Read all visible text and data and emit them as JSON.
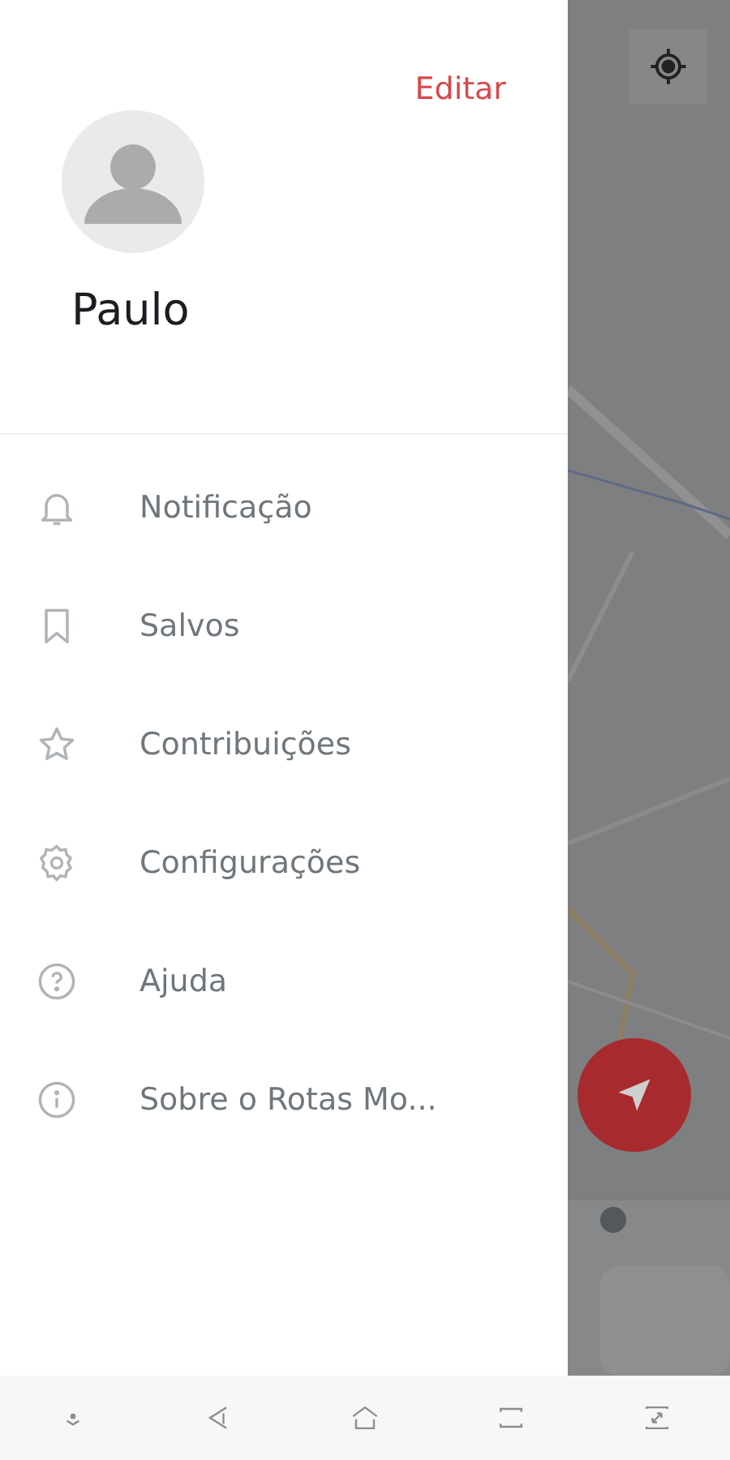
{
  "drawer": {
    "edit_link": "Editar",
    "user": {
      "name": "Paulo"
    },
    "menu": [
      {
        "kind": "bell",
        "label": "Notificação"
      },
      {
        "kind": "bookmark",
        "label": "Salvos"
      },
      {
        "kind": "star",
        "label": "Contribuições"
      },
      {
        "kind": "gear",
        "label": "Configurações"
      },
      {
        "kind": "help",
        "label": "Ajuda"
      },
      {
        "kind": "info",
        "label": "Sobre o Rotas Mo..."
      }
    ]
  },
  "nav_bar": [
    {
      "kind": "hide"
    },
    {
      "kind": "back"
    },
    {
      "kind": "home"
    },
    {
      "kind": "recents"
    },
    {
      "kind": "expand"
    }
  ]
}
